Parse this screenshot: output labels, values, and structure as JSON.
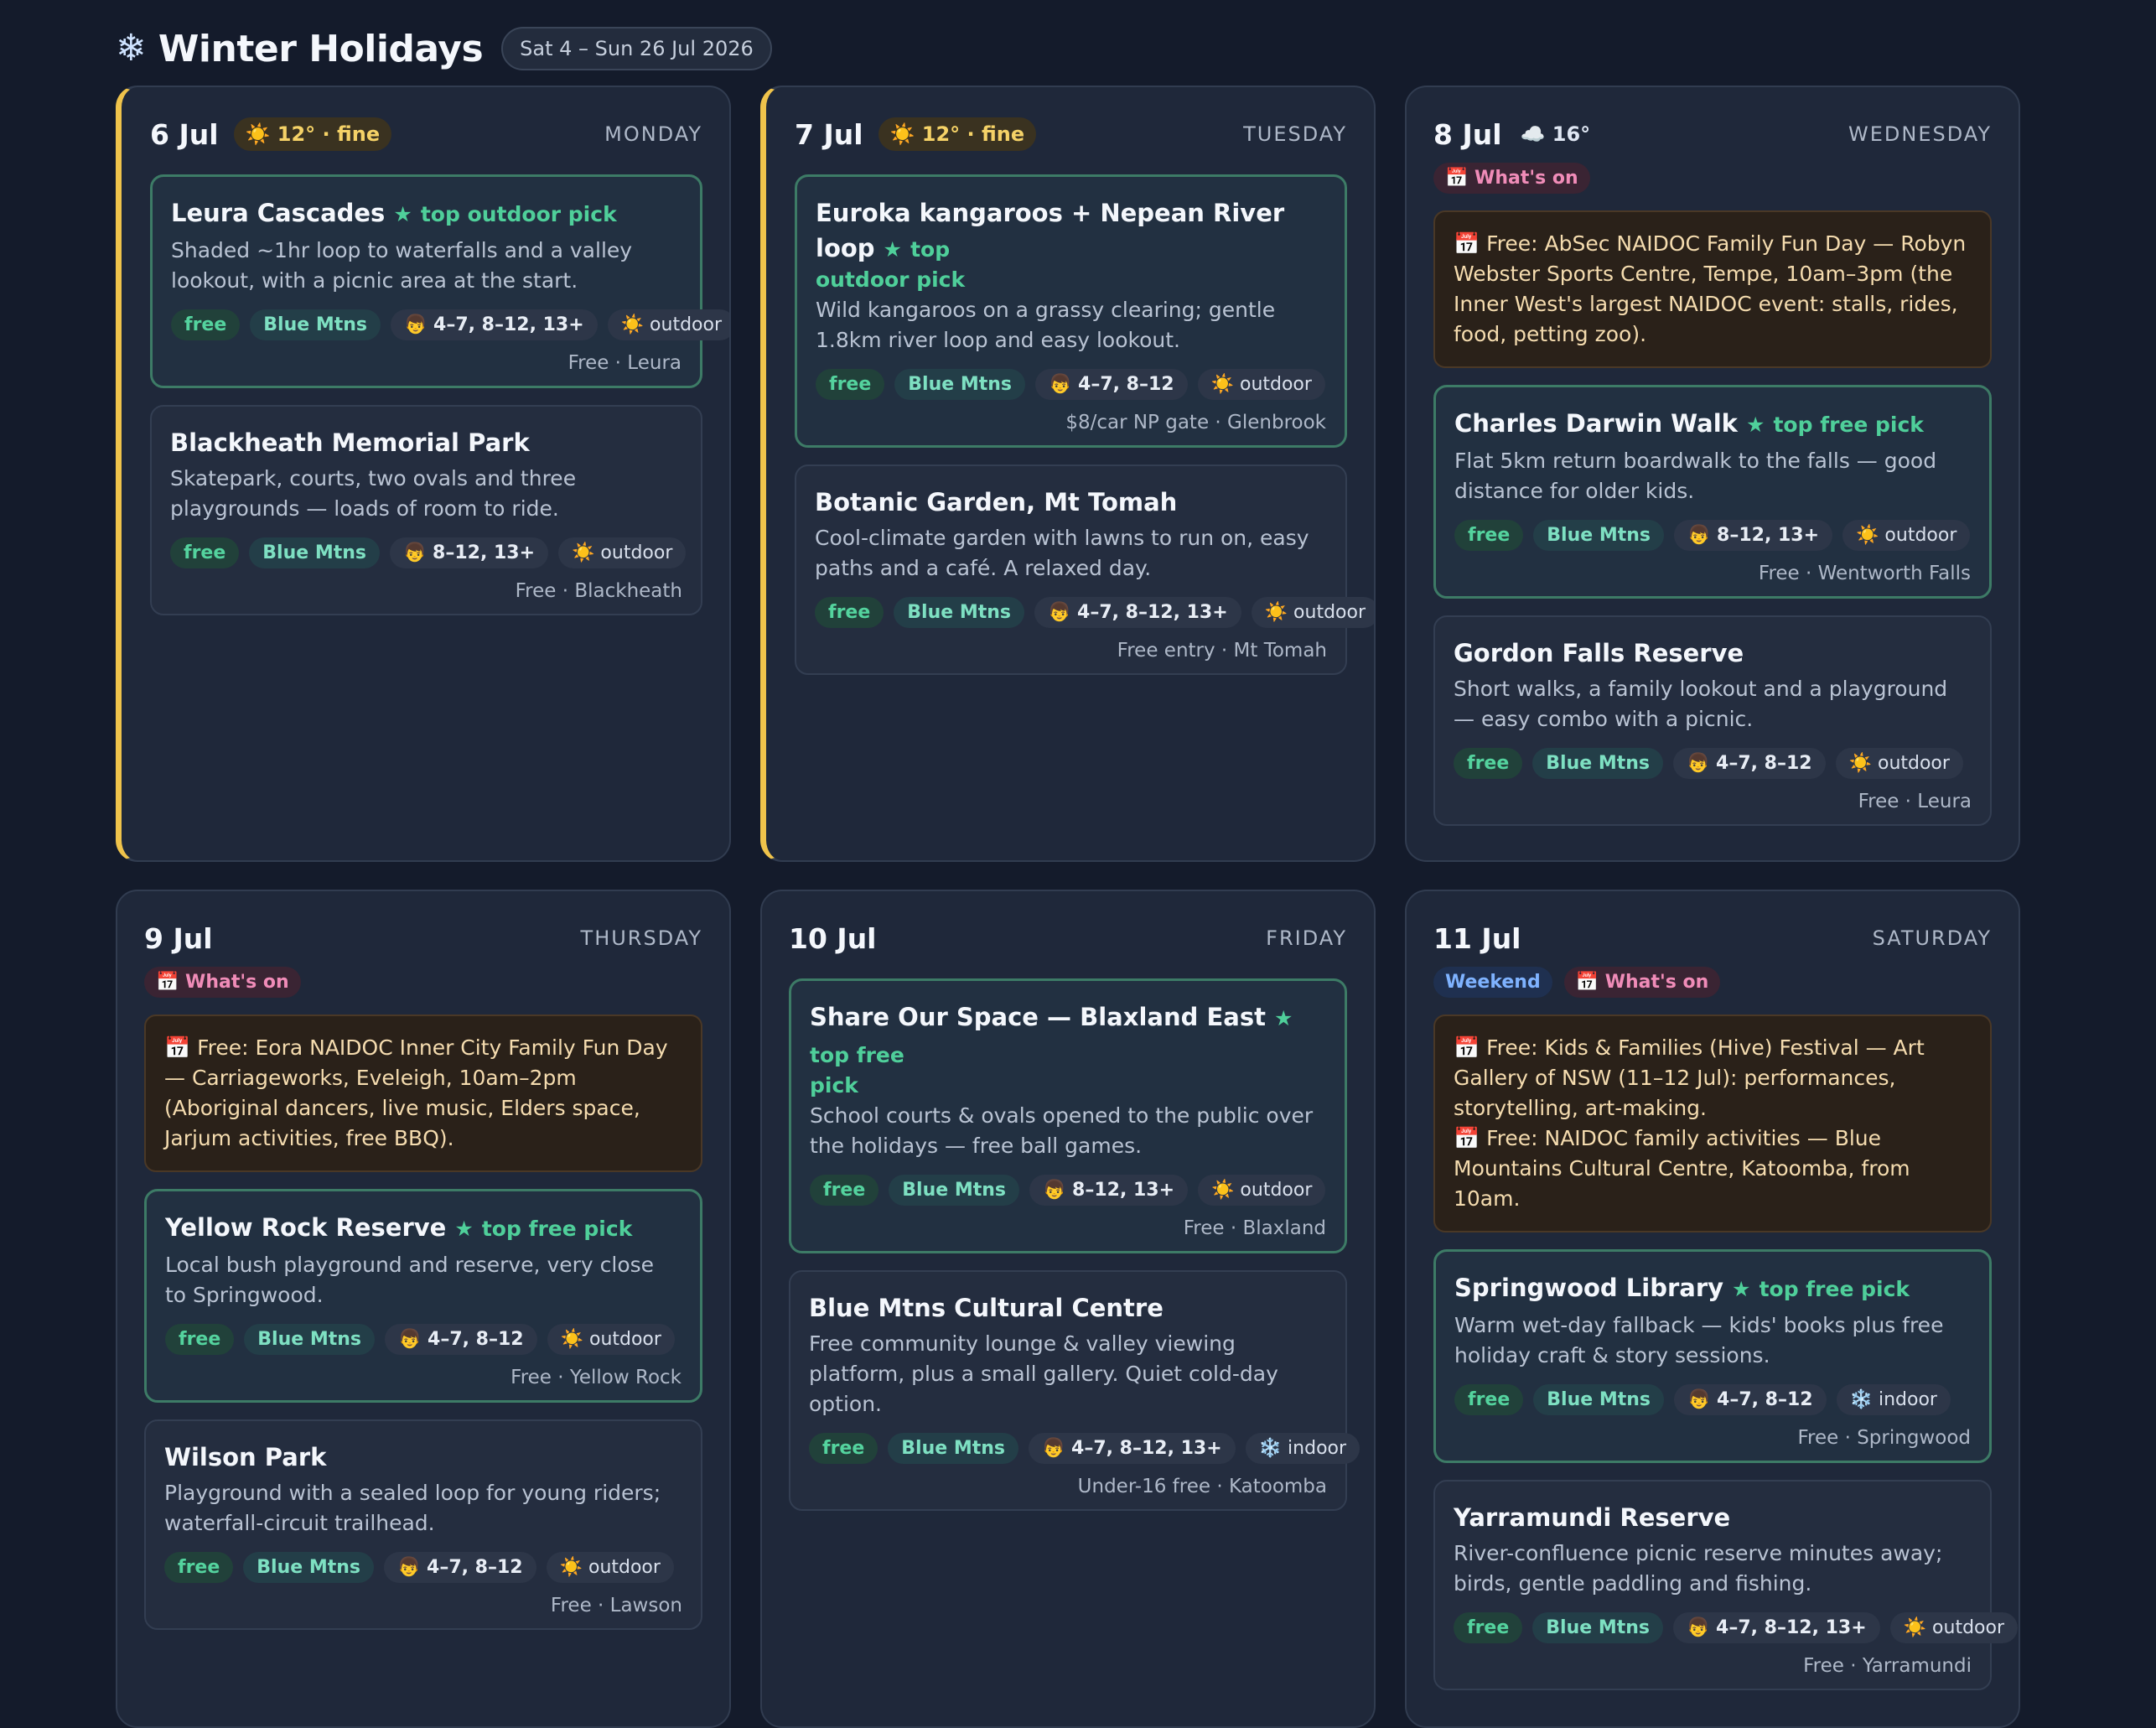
{
  "header": {
    "icon": "snowflake-icon",
    "title": "Winter Holidays",
    "range": "Sat 4 – Sun 26 Jul 2026"
  },
  "colors": {
    "today_accent": "#efc34b",
    "pick_green": "#4fcf9a",
    "event_text": "#f5dcaf"
  },
  "days": [
    {
      "date": "6 Jul",
      "weather": "☀️ 12° · fine",
      "weekday": "MONDAY",
      "cards": [
        {
          "name": "Leura Cascades",
          "pick": "top outdoor pick",
          "desc": "Shaded ~1hr loop to waterfalls and a valley lookout, with a picnic area at the start.",
          "chips": [
            "free",
            "Blue Mtns",
            "👦 4–7, 8–12, 13+",
            "☀️ outdoor"
          ],
          "foot": "Free · Leura"
        },
        {
          "name": "Blackheath Memorial Park",
          "pick": "",
          "desc": "Skatepark, courts, two ovals and three playgrounds — loads of room to ride.",
          "chips": [
            "free",
            "Blue Mtns",
            "👦 8–12, 13+",
            "☀️ outdoor"
          ],
          "foot": "Free · Blackheath"
        }
      ]
    },
    {
      "date": "7 Jul",
      "weather": "☀️ 12° · fine",
      "weekday": "TUESDAY",
      "cards": [
        {
          "name": "Euroka kangaroos + Nepean River loop",
          "pick": "top",
          "pick2": "outdoor pick",
          "desc": "Wild kangaroos on a grassy clearing; gentle 1.8km river loop and easy lookout.",
          "chips": [
            "free",
            "Blue Mtns",
            "👦 4–7, 8–12",
            "☀️ outdoor"
          ],
          "foot": "$8/car NP gate · Glenbrook"
        },
        {
          "name": "Botanic Garden, Mt Tomah",
          "pick": "",
          "desc": "Cool-climate garden with lawns to run on, easy paths and a café. A relaxed day.",
          "chips": [
            "free",
            "Blue Mtns",
            "👦 4–7, 8–12, 13+",
            "☀️ outdoor"
          ],
          "foot": "Free entry · Mt Tomah"
        }
      ]
    },
    {
      "date": "8 Jul",
      "weather": "☁️ 16°",
      "weekday": "WEDNESDAY",
      "whats_on": "📅 What's on",
      "events": [
        "📅 Free: AbSec NAIDOC Family Fun Day — Robyn Webster Sports Centre, Tempe, 10am–3pm (the Inner West's largest NAIDOC event: stalls, rides, food, petting zoo)."
      ],
      "cards": [
        {
          "name": "Charles Darwin Walk",
          "pick": "top free pick",
          "desc": "Flat 5km return boardwalk to the falls — good distance for older kids.",
          "chips": [
            "free",
            "Blue Mtns",
            "👦 8–12, 13+",
            "☀️ outdoor"
          ],
          "foot": "Free · Wentworth Falls"
        },
        {
          "name": "Gordon Falls Reserve",
          "pick": "",
          "desc": "Short walks, a family lookout and a playground — easy combo with a picnic.",
          "chips": [
            "free",
            "Blue Mtns",
            "👦 4–7, 8–12",
            "☀️ outdoor"
          ],
          "foot": "Free · Leura"
        }
      ]
    },
    {
      "date": "9 Jul",
      "weekday": "THURSDAY",
      "whats_on": "📅 What's on",
      "events": [
        "📅 Free: Eora NAIDOC Inner City Family Fun Day — Carriageworks, Eveleigh, 10am–2pm (Aboriginal dancers, live music, Elders space, Jarjum activities, free BBQ)."
      ],
      "cards": [
        {
          "name": "Yellow Rock Reserve",
          "pick": "top free pick",
          "desc": "Local bush playground and reserve, very close to Springwood.",
          "chips": [
            "free",
            "Blue Mtns",
            "👦 4–7, 8–12",
            "☀️ outdoor"
          ],
          "foot": "Free · Yellow Rock"
        },
        {
          "name": "Wilson Park",
          "pick": "",
          "desc": "Playground with a sealed loop for young riders; waterfall-circuit trailhead.",
          "chips": [
            "free",
            "Blue Mtns",
            "👦 4–7, 8–12",
            "☀️ outdoor"
          ],
          "foot": "Free · Lawson"
        }
      ]
    },
    {
      "date": "10 Jul",
      "weekday": "FRIDAY",
      "cards": [
        {
          "name": "Share Our Space — Blaxland East",
          "pick": "top free",
          "pick2": "pick",
          "desc": "School courts & ovals opened to the public over the holidays — free ball games.",
          "chips": [
            "free",
            "Blue Mtns",
            "👦 8–12, 13+",
            "☀️ outdoor"
          ],
          "foot": "Free · Blaxland"
        },
        {
          "name": "Blue Mtns Cultural Centre",
          "pick": "",
          "desc": "Free community lounge & valley viewing platform, plus a small gallery. Quiet cold-day option.",
          "chips": [
            "free",
            "Blue Mtns",
            "👦 4–7, 8–12, 13+",
            "❄️ indoor"
          ],
          "foot": "Under-16 free · Katoomba"
        }
      ]
    },
    {
      "date": "11 Jul",
      "weekday": "SATURDAY",
      "weekend": "Weekend",
      "whats_on": "📅 What's on",
      "events": [
        "📅 Free: Kids & Families (Hive) Festival — Art Gallery of NSW (11–12 Jul): performances, storytelling, art-making.",
        "📅 Free: NAIDOC family activities — Blue Mountains Cultural Centre, Katoomba, from 10am."
      ],
      "cards": [
        {
          "name": "Springwood Library",
          "pick": "top free pick",
          "desc": "Warm wet-day fallback — kids' books plus free holiday craft & story sessions.",
          "chips": [
            "free",
            "Blue Mtns",
            "👦 4–7, 8–12",
            "❄️ indoor"
          ],
          "foot": "Free · Springwood"
        },
        {
          "name": "Yarramundi Reserve",
          "pick": "",
          "desc": "River-confluence picnic reserve minutes away; birds, gentle paddling and fishing.",
          "chips": [
            "free",
            "Blue Mtns",
            "👦 4–7, 8–12, 13+",
            "☀️ outdoor"
          ],
          "foot": "Free · Yarramundi"
        }
      ]
    }
  ]
}
